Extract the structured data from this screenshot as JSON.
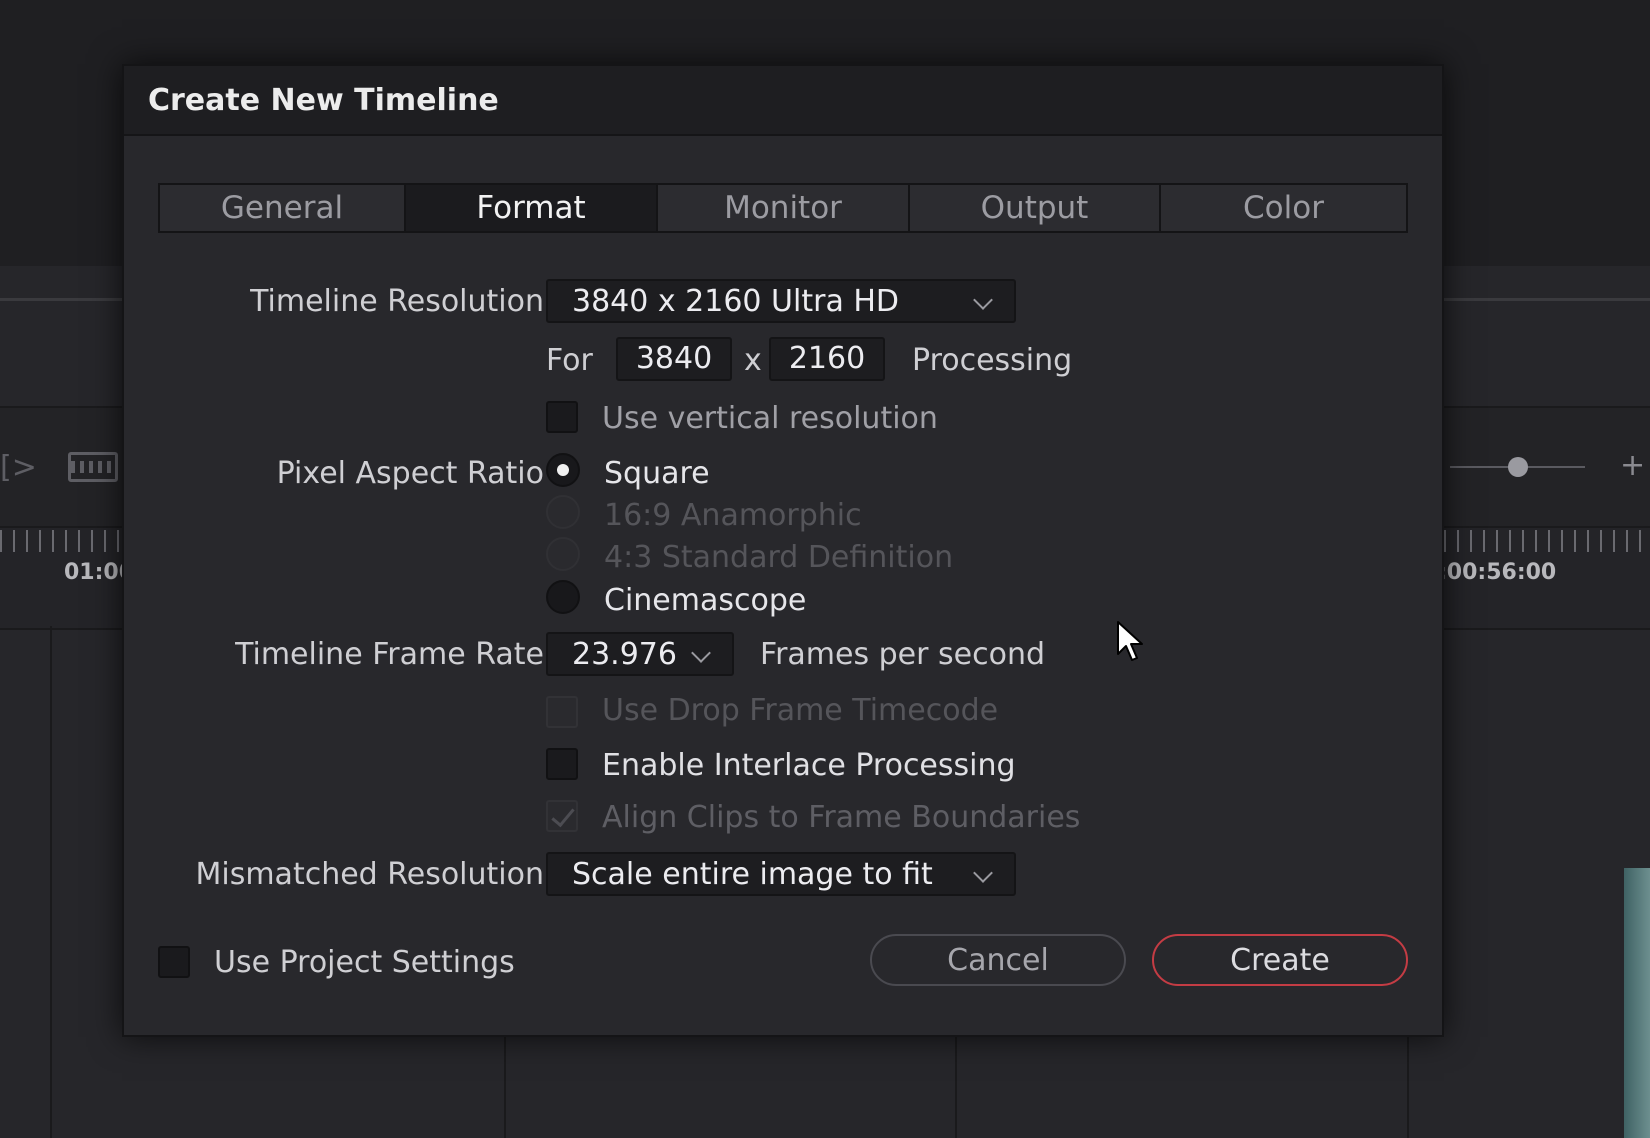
{
  "background": {
    "timecode_left": "01:00",
    "timecode_right": ":00:56:00"
  },
  "dialog": {
    "title": "Create New Timeline",
    "tabs": [
      {
        "label": "General"
      },
      {
        "label": "Format"
      },
      {
        "label": "Monitor"
      },
      {
        "label": "Output"
      },
      {
        "label": "Color"
      }
    ],
    "active_tab": "Format",
    "timeline_resolution": {
      "label": "Timeline Resolution",
      "value": "3840 x 2160 Ultra HD",
      "for_label": "For",
      "width": "3840",
      "x_label": "x",
      "height": "2160",
      "processing_label": "Processing",
      "use_vertical_label": "Use vertical resolution"
    },
    "pixel_aspect_ratio": {
      "label": "Pixel Aspect Ratio",
      "options": [
        {
          "label": "Square",
          "selected": true,
          "disabled": false
        },
        {
          "label": "16:9 Anamorphic",
          "selected": false,
          "disabled": true
        },
        {
          "label": "4:3 Standard Definition",
          "selected": false,
          "disabled": true
        },
        {
          "label": "Cinemascope",
          "selected": false,
          "disabled": false
        }
      ]
    },
    "frame_rate": {
      "label": "Timeline Frame Rate",
      "value": "23.976",
      "unit": "Frames per second"
    },
    "options": {
      "drop_frame": "Use Drop Frame Timecode",
      "interlace": "Enable Interlace Processing",
      "align_clips": "Align Clips to Frame Boundaries"
    },
    "mismatched_resolution": {
      "label": "Mismatched Resolution",
      "value": "Scale entire image to fit"
    },
    "use_project_settings": "Use Project Settings",
    "buttons": {
      "cancel": "Cancel",
      "create": "Create"
    },
    "colors": {
      "accent_create_border": "#c43c44",
      "dialog_bg": "#28282c"
    }
  }
}
